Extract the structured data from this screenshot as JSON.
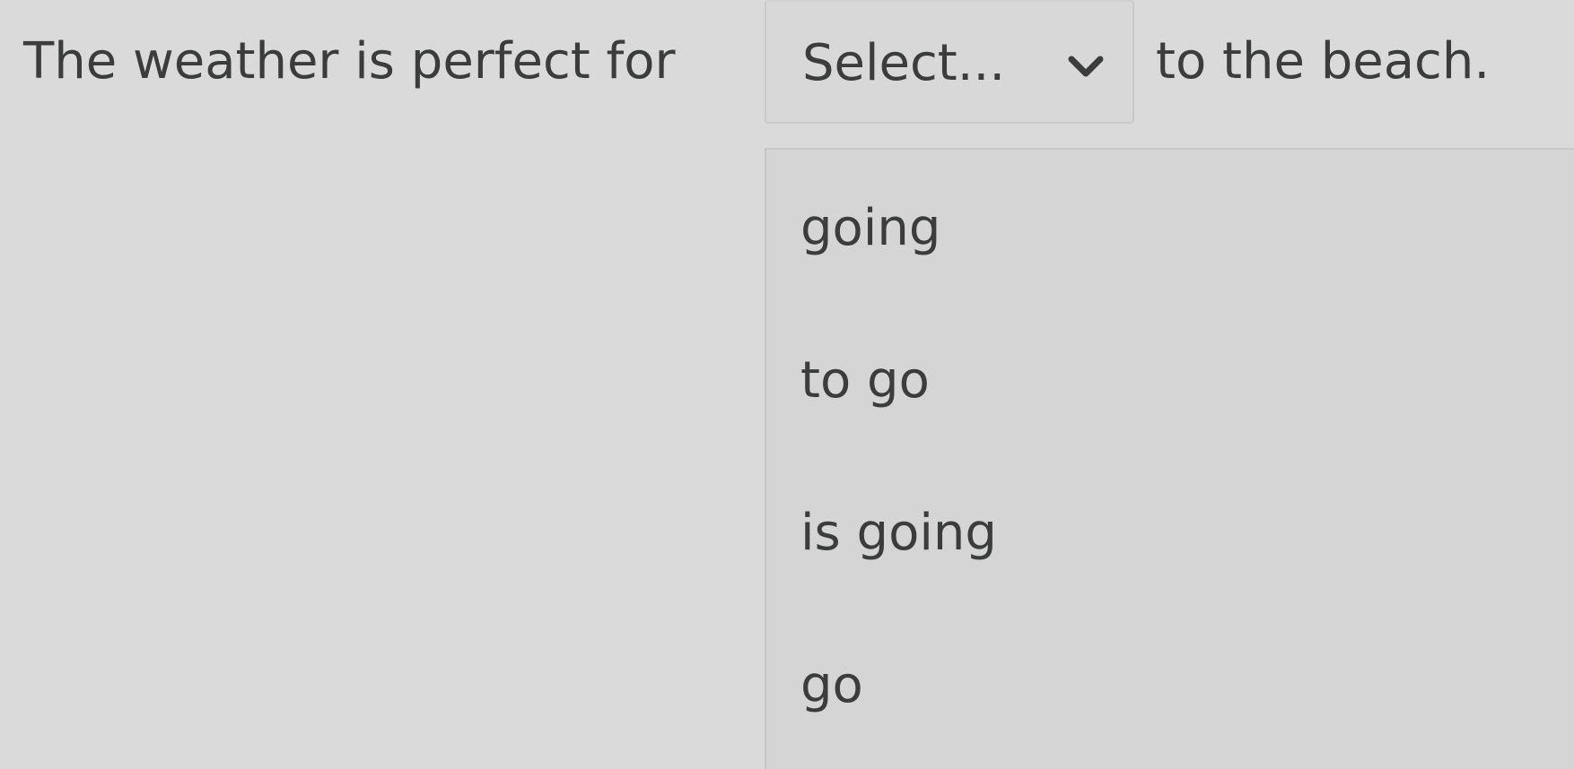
{
  "sentence": {
    "before": "The weather is perfect for",
    "after": "to the beach."
  },
  "select": {
    "placeholder": "Select...",
    "icon": "chevron-down-icon"
  },
  "dropdown": {
    "options": [
      {
        "label": "going"
      },
      {
        "label": "to go"
      },
      {
        "label": "is going"
      },
      {
        "label": "go"
      }
    ]
  },
  "colors": {
    "background": "#d9dad9",
    "text": "#3a3d3b",
    "border": "#c8cac8"
  }
}
